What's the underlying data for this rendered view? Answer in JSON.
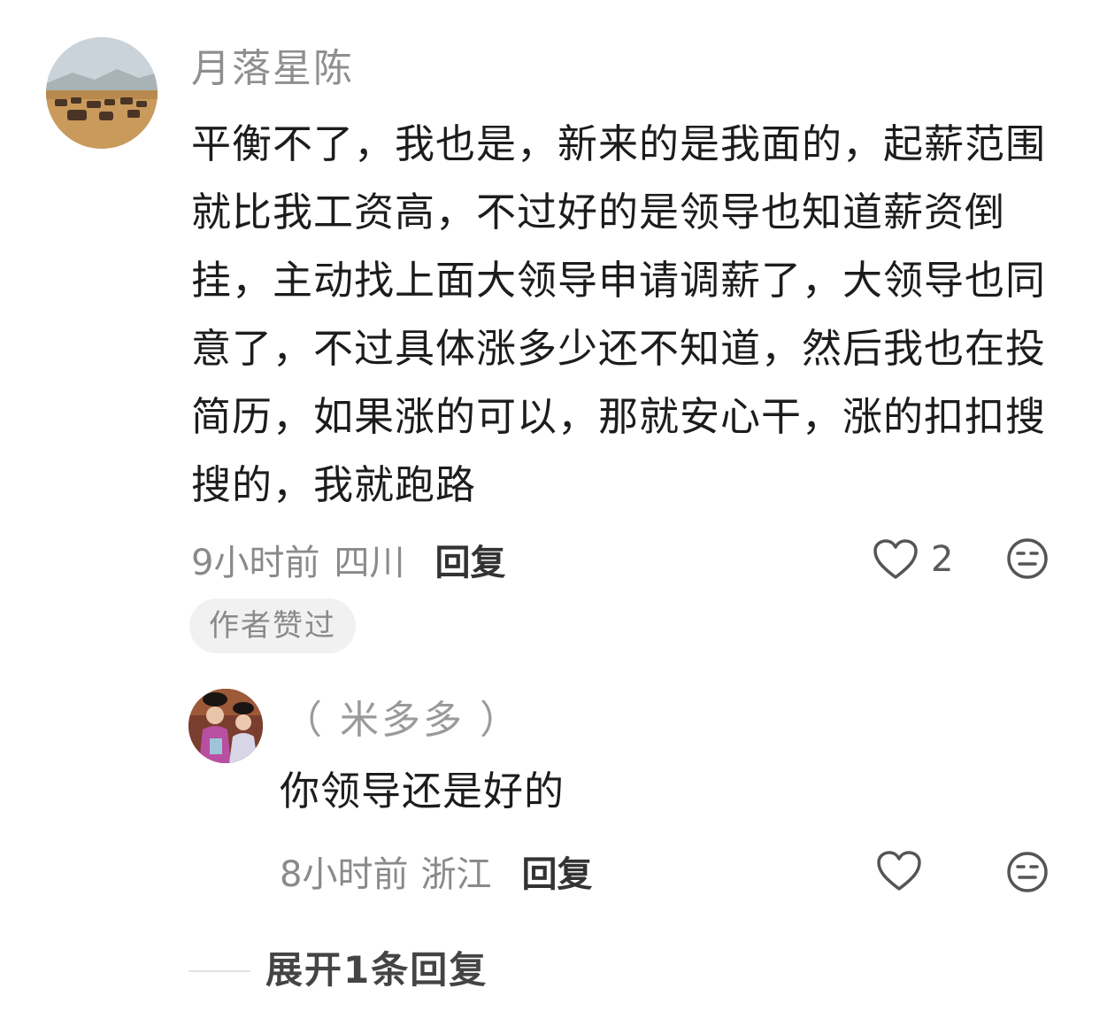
{
  "main_comment": {
    "username": "月落星陈",
    "text": "平衡不了，我也是，新来的是我面的，起薪范围就比我工资高，不过好的是领导也知道薪资倒挂，主动找上面大领导申请调薪了，大领导也同意了，不过具体涨多少还不知道，然后我也在投简历，如果涨的可以，那就安心干，涨的扣扣搜搜的，我就跑路",
    "time": "9小时前",
    "location": "四川",
    "reply_label": "回复",
    "like_count": "2",
    "badge": "作者赞过"
  },
  "reply": {
    "username": "（ 米多多 ）",
    "text": "你领导还是好的",
    "time": "8小时前",
    "location": "浙江",
    "reply_label": "回复"
  },
  "expand_label": "展开1条回复",
  "icons": {
    "like": "heart-icon",
    "dislike": "meh-face-icon"
  },
  "colors": {
    "meta_gray": "#8a8a8a",
    "text": "#1c1c1c",
    "badge_bg": "#f1f1f1"
  }
}
